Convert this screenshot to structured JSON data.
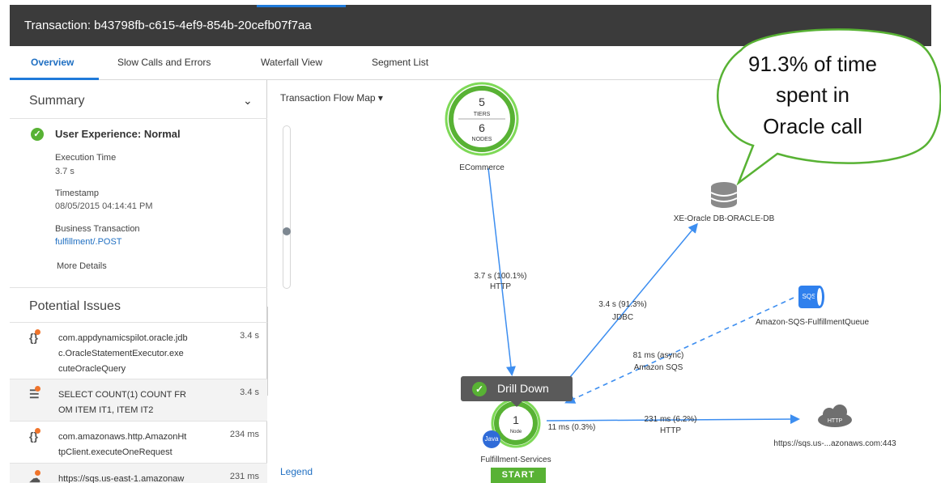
{
  "window": {
    "title": "Transaction: b43798fb-c615-4ef9-854b-20cefb07f7aa"
  },
  "tabs": [
    {
      "label": "Overview"
    },
    {
      "label": "Slow Calls and Errors"
    },
    {
      "label": "Waterfall View"
    },
    {
      "label": "Segment List"
    }
  ],
  "summary": {
    "title": "Summary",
    "user_experience": "User Experience: Normal",
    "execution_time_label": "Execution Time",
    "execution_time_value": "3.7 s",
    "timestamp_label": "Timestamp",
    "timestamp_value": "08/05/2015 04:14:41 PM",
    "business_tx_label": "Business Transaction",
    "business_tx_value": "fulfillment/.POST",
    "more_details": "More Details"
  },
  "potential_issues": {
    "title": "Potential Issues",
    "items": [
      {
        "text": "com.appdynamicspilot.oracle.jdbc.OracleStatementExecutor.executeOracleQuery",
        "time": "3.4 s",
        "icon": "code-warning-icon"
      },
      {
        "text": "SELECT COUNT(1) COUNT FROM ITEM IT1, ITEM IT2",
        "time": "3.4 s",
        "icon": "database-warning-icon"
      },
      {
        "text": "com.amazonaws.http.AmazonHttpClient.executeOneRequest",
        "time": "234 ms",
        "icon": "code-warning-icon"
      },
      {
        "text": "https://sqs.us-east-1.amazonaw",
        "time": "231 ms",
        "icon": "cloud-warning-icon"
      }
    ]
  },
  "flow_map": {
    "menu_label": "Transaction Flow Map ▾",
    "legend": "Legend",
    "ecommerce": {
      "tiers_count": "5",
      "tiers_label": "TIERS",
      "nodes_count": "6",
      "nodes_label": "NODES",
      "name": "ECommerce"
    },
    "oracle": {
      "name": "XE-Oracle DB-ORACLE-DB"
    },
    "sqs": {
      "name": "Amazon-SQS-FulfillmentQueue",
      "badge": "SQS"
    },
    "fulfillment": {
      "count": "1",
      "label": "Node",
      "name": "Fulfillment-Services",
      "java": "Java",
      "start": "START"
    },
    "http_ext": {
      "name": "https://sqs.us-...azonaws.com:443",
      "badge": "HTTP"
    },
    "edges": {
      "ecommerce_to_ful": {
        "time": "3.7 s (100.1%)",
        "proto": "HTTP"
      },
      "ful_to_oracle": {
        "time": "3.4 s (91.3%)",
        "proto": "JDBC"
      },
      "ful_to_sqs": {
        "time": "81 ms (async)",
        "proto": "Amazon SQS"
      },
      "ful_self": {
        "time": "11 ms (0.3%)"
      },
      "ful_to_http": {
        "time": "231 ms (6.2%)",
        "proto": "HTTP"
      }
    },
    "drill_down": "Drill Down"
  },
  "callout": {
    "lines": [
      "91.3% of time",
      "spent in",
      "Oracle call"
    ]
  },
  "colors": {
    "accent_blue": "#1f7ad9",
    "success_green": "#58b234",
    "titlebar": "#3b3b3b",
    "edge_blue": "#3d8ef0"
  }
}
